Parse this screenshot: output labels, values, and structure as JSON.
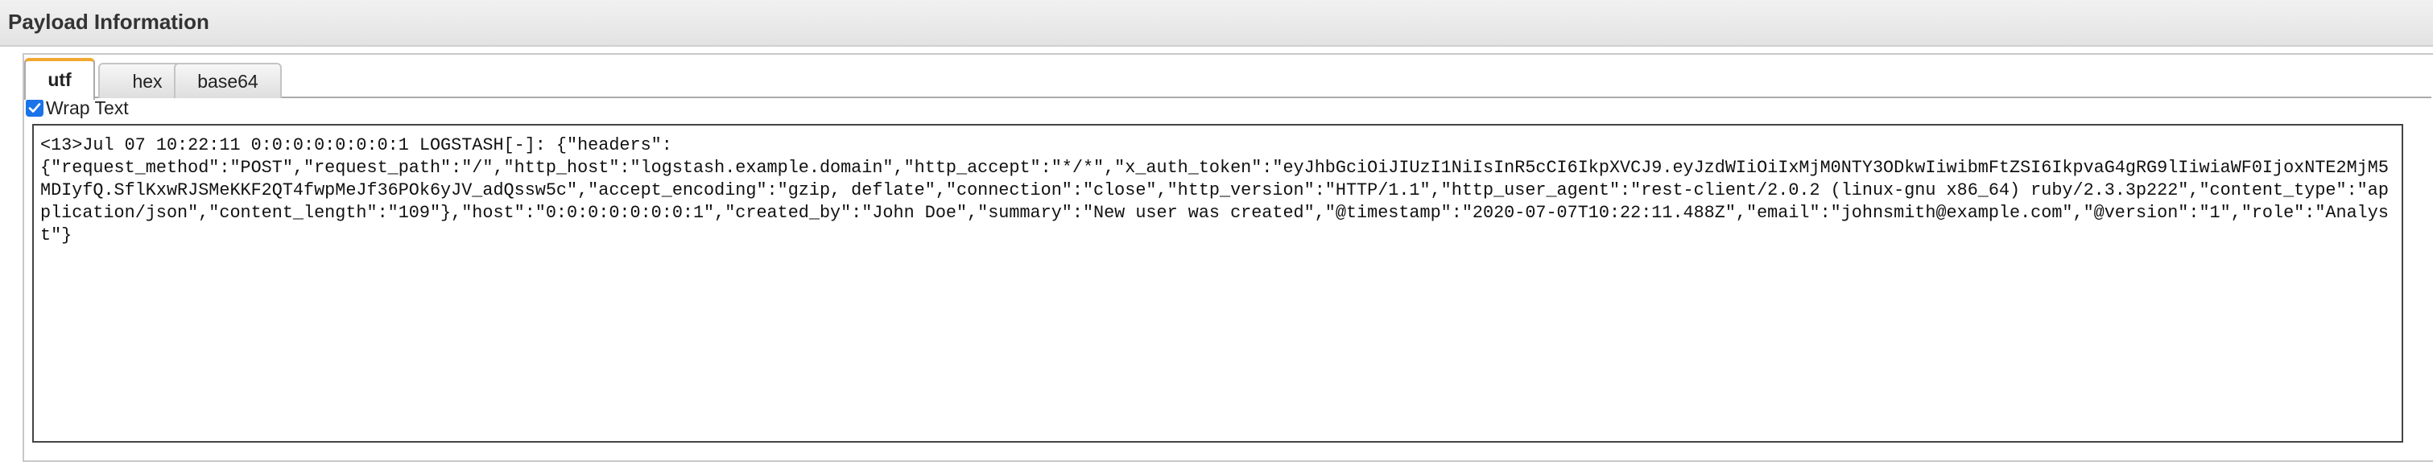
{
  "header": {
    "title": "Payload Information"
  },
  "tabs": [
    {
      "label": "utf",
      "active": true
    },
    {
      "label": "hex",
      "active": false
    },
    {
      "label": "base64",
      "active": false
    }
  ],
  "wrap_text": {
    "label": "Wrap Text",
    "checked": true
  },
  "payload": {
    "text": "<13>Jul 07 10:22:11 0:0:0:0:0:0:0:1 LOGSTASH[-]: {\"headers\":\n{\"request_method\":\"POST\",\"request_path\":\"/\",\"http_host\":\"logstash.example.domain\",\"http_accept\":\"*/*\",\"x_auth_token\":\"eyJhbGciOiJIUzI1NiIsInR5cCI6IkpXVCJ9.eyJzdWIiOiIxMjM0NTY3ODkwIiwibmFtZSI6IkpvaG4gRG9lIiwiaWF0IjoxNTE2MjM5MDIyfQ.SflKxwRJSMeKKF2QT4fwpMeJf36POk6yJV_adQssw5c\",\"accept_encoding\":\"gzip, deflate\",\"connection\":\"close\",\"http_version\":\"HTTP/1.1\",\"http_user_agent\":\"rest-client/2.0.2 (linux-gnu x86_64) ruby/2.3.3p222\",\"content_type\":\"application/json\",\"content_length\":\"109\"},\"host\":\"0:0:0:0:0:0:0:1\",\"created_by\":\"John Doe\",\"summary\":\"New user was created\",\"@timestamp\":\"2020-07-07T10:22:11.488Z\",\"email\":\"johnsmith@example.com\",\"@version\":\"1\",\"role\":\"Analyst\"}"
  },
  "colors": {
    "checkbox_accent": "#1a73e8",
    "active_tab_top": "#f0a830"
  }
}
